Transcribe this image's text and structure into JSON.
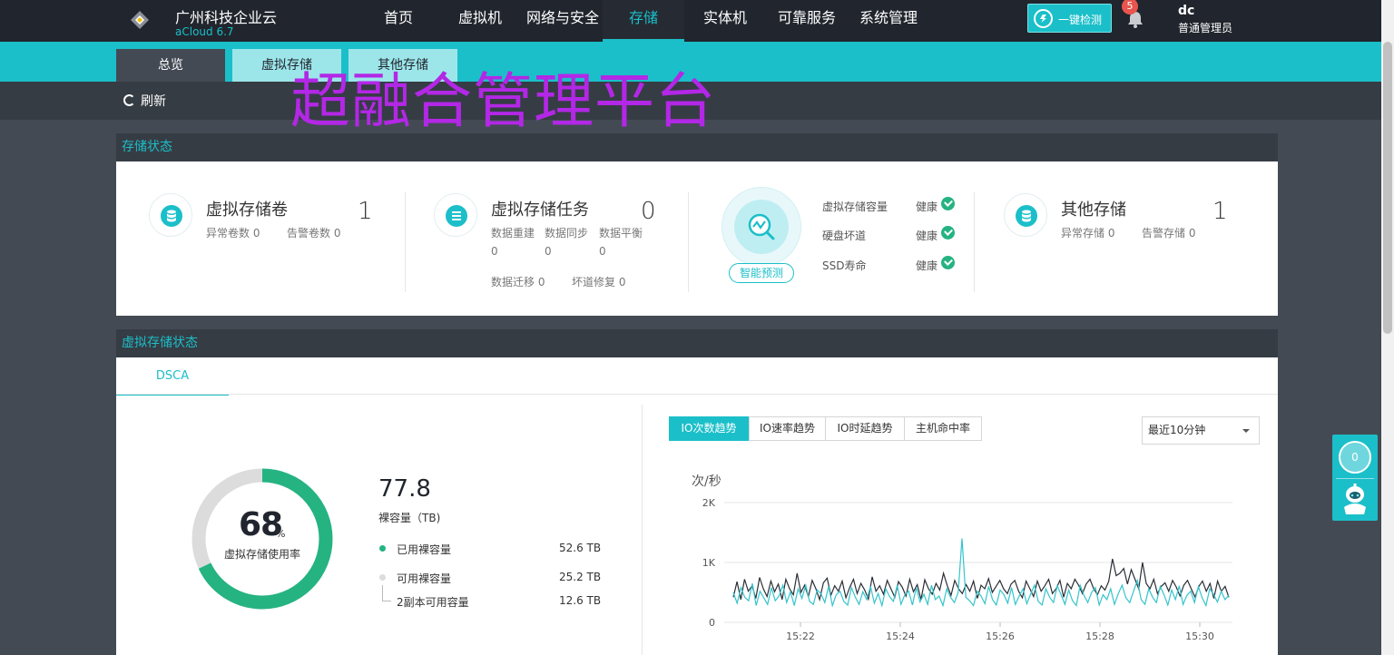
{
  "app": {
    "brand_name": "广州科技企业云",
    "version": "aCloud 6.7",
    "overlay_title": "超融合管理平台"
  },
  "nav": {
    "items": [
      {
        "label": "首页"
      },
      {
        "label": "虚拟机"
      },
      {
        "label": "网络与安全"
      },
      {
        "label": "存储",
        "active": true
      },
      {
        "label": "实体机"
      },
      {
        "label": "可靠服务"
      },
      {
        "label": "系统管理"
      }
    ],
    "check_label": "一键检测",
    "notification_count": "5",
    "user_name": "dc",
    "user_role": "普通管理员"
  },
  "subnav": {
    "tabs": [
      {
        "label": "总览",
        "active": true
      },
      {
        "label": "虚拟存储"
      },
      {
        "label": "其他存储"
      }
    ],
    "refresh_label": "刷新"
  },
  "storage_status": {
    "title": "存储状态",
    "virtual_volume": {
      "title": "虚拟存储卷",
      "count": "1",
      "abnormal": "异常卷数 0",
      "alarm": "告警卷数 0"
    },
    "virtual_task": {
      "title": "虚拟存储任务",
      "count": "0",
      "rebuild_label": "数据重建",
      "rebuild_val": "0",
      "sync_label": "数据同步",
      "sync_val": "0",
      "balance_label": "数据平衡",
      "balance_val": "0",
      "migrate": "数据迁移 0",
      "repair": "坏道修复 0"
    },
    "smart_predict": {
      "button": "智能预测",
      "checks": [
        {
          "label": "虚拟存储容量",
          "value": "健康"
        },
        {
          "label": "硬盘坏道",
          "value": "健康"
        },
        {
          "label": "SSD寿命",
          "value": "健康"
        }
      ]
    },
    "other_storage": {
      "title": "其他存储",
      "count": "1",
      "abnormal": "异常存储 0",
      "alarm": "告警存储 0"
    }
  },
  "virtual_state": {
    "title": "虚拟存储状态",
    "tab": "DSCA",
    "usage_percent": "68",
    "usage_unit": "%",
    "usage_fraction": 0.68,
    "usage_label": "虚拟存储使用率",
    "raw_capacity": "77.8",
    "raw_capacity_label": "裸容量（TB)",
    "used_label": "已用裸容量",
    "used_value": "52.6 TB",
    "available_label": "可用裸容量",
    "available_value": "25.2 TB",
    "replica_label": "2副本可用容量",
    "replica_value": "12.6 TB",
    "colors": {
      "used": "#25b382",
      "free": "#dcdcdc",
      "accent": "#1bbfc9"
    }
  },
  "io_panel": {
    "tabs": [
      {
        "label": "IO次数趋势",
        "active": true
      },
      {
        "label": "IO速率趋势"
      },
      {
        "label": "IO时延趋势"
      },
      {
        "label": "主机命中率"
      }
    ],
    "range_select": "最近10分钟",
    "unit_label": "次/秒"
  },
  "chart_data": {
    "type": "line",
    "ylim": [
      0,
      2000
    ],
    "yticks": [
      "2K",
      "1K",
      "0"
    ],
    "xticks": [
      "15:22",
      "15:24",
      "15:26",
      "15:28",
      "15:30"
    ],
    "series": [
      {
        "color": "#2a2f36",
        "values": [
          420,
          680,
          380,
          720,
          520,
          610,
          400,
          750,
          560,
          430,
          690,
          510,
          640,
          380,
          720,
          560,
          460,
          820,
          500,
          620,
          430,
          700,
          560,
          380,
          660,
          740,
          450,
          610,
          520,
          690,
          410,
          580,
          720,
          480,
          650,
          540,
          390,
          760,
          520,
          610,
          470,
          700,
          560,
          420,
          680,
          590,
          440,
          720,
          510,
          630,
          380,
          710,
          560,
          470,
          650,
          540,
          820,
          610,
          450,
          700,
          560,
          480,
          630,
          520,
          690,
          400,
          620,
          560,
          730,
          500,
          600,
          700,
          560,
          480,
          640,
          700,
          520,
          410,
          690,
          560,
          430,
          690,
          520,
          610,
          720,
          480,
          560,
          700,
          420,
          650,
          560,
          720,
          620,
          480,
          640,
          720,
          560,
          460,
          610,
          540,
          680,
          1060,
          780,
          820,
          900,
          640,
          880,
          720,
          560,
          1000,
          650,
          560,
          720,
          480,
          600,
          660,
          520,
          700,
          590,
          440,
          620,
          700,
          560,
          420,
          600,
          690,
          520,
          650,
          400,
          690,
          520,
          600,
          420
        ]
      },
      {
        "color": "#35c4cc",
        "values": [
          500,
          320,
          580,
          420,
          360,
          650,
          280,
          520,
          410,
          300,
          580,
          360,
          440,
          620,
          330,
          510,
          280,
          560,
          400,
          620,
          350,
          300,
          540,
          480,
          330,
          600,
          280,
          460,
          520,
          350,
          290,
          580,
          420,
          300,
          510,
          380,
          600,
          320,
          480,
          280,
          560,
          430,
          350,
          620,
          300,
          460,
          520,
          290,
          580,
          340,
          470,
          300,
          620,
          380,
          440,
          280,
          560,
          420,
          330,
          500,
          1400,
          420,
          360,
          280,
          520,
          440,
          310,
          600,
          380,
          290,
          540,
          460,
          320,
          580,
          300,
          440,
          560,
          310,
          470,
          620,
          350,
          290,
          560,
          420,
          330,
          610,
          460,
          300,
          540,
          360,
          280,
          620,
          450,
          330,
          500,
          580,
          290,
          460,
          380,
          560,
          300,
          480,
          620,
          410,
          330,
          520,
          700,
          380,
          300,
          560,
          420,
          330,
          600,
          460,
          290,
          540,
          380,
          610,
          300,
          450,
          520,
          330,
          600,
          410,
          280,
          560,
          470,
          340,
          520,
          380,
          450
        ]
      }
    ]
  }
}
